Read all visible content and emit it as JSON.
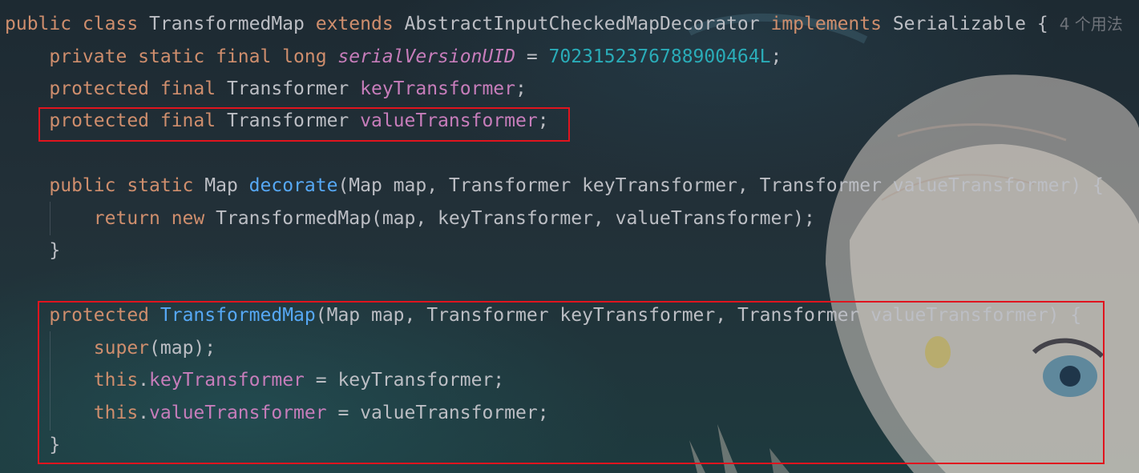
{
  "code": {
    "line0": {
      "kw1": "public class ",
      "cls": "TransformedMap ",
      "kw2": "extends ",
      "parent": "AbstractInputCheckedMapDecorator ",
      "kw3": "implements ",
      "iface": "Serializable {",
      "hint": "4 个用法"
    },
    "line1": {
      "kw": "private static final long ",
      "field": "serialVersionUID",
      "eq": " = ",
      "num": "7023152376788900464L",
      "end": ";"
    },
    "line2": {
      "kw": "protected final ",
      "type": "Transformer ",
      "field": "keyTransformer",
      "end": ";"
    },
    "line3": {
      "kw": "protected final ",
      "type": "Transformer ",
      "field": "valueTransformer",
      "end": ";"
    },
    "line4": {
      "kw": "public static ",
      "type": "Map ",
      "method": "decorate",
      "params": "(Map map, Transformer keyTransformer, Transformer valueTransformer) {"
    },
    "line5": {
      "kw": "return new ",
      "rest": "TransformedMap(map, keyTransformer, valueTransformer);"
    },
    "line6": {
      "text": "}"
    },
    "line7": {
      "kw": "protected ",
      "ctor": "TransformedMap",
      "params": "(Map map, Transformer keyTransformer, Transformer valueTransformer) {"
    },
    "line8": {
      "kw": "super",
      "rest": "(map);"
    },
    "line9": {
      "kw": "this",
      "dot": ".",
      "field": "keyTransformer",
      "rest": " = keyTransformer;"
    },
    "line10": {
      "kw": "this",
      "dot": ".",
      "field": "valueTransformer",
      "rest": " = valueTransformer;"
    },
    "line11": {
      "text": "}"
    }
  },
  "colors": {
    "keyword": "#cf8e6d",
    "field": "#c77dbb",
    "number": "#2aacb8",
    "method": "#56a8f5",
    "plain": "#bcbec4",
    "highlight_box": "#e0141e"
  },
  "icons": {
    "background": "anime-character-illustration"
  }
}
